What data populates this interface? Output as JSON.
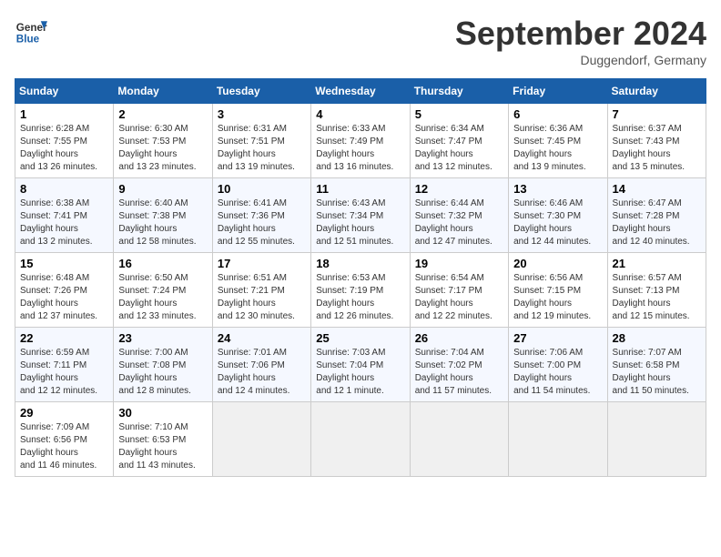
{
  "header": {
    "logo_line1": "General",
    "logo_line2": "Blue",
    "month": "September 2024",
    "location": "Duggendorf, Germany"
  },
  "weekdays": [
    "Sunday",
    "Monday",
    "Tuesday",
    "Wednesday",
    "Thursday",
    "Friday",
    "Saturday"
  ],
  "weeks": [
    [
      {
        "day": "1",
        "sunrise": "6:28 AM",
        "sunset": "7:55 PM",
        "daylight": "13 hours and 26 minutes."
      },
      {
        "day": "2",
        "sunrise": "6:30 AM",
        "sunset": "7:53 PM",
        "daylight": "13 hours and 23 minutes."
      },
      {
        "day": "3",
        "sunrise": "6:31 AM",
        "sunset": "7:51 PM",
        "daylight": "13 hours and 19 minutes."
      },
      {
        "day": "4",
        "sunrise": "6:33 AM",
        "sunset": "7:49 PM",
        "daylight": "13 hours and 16 minutes."
      },
      {
        "day": "5",
        "sunrise": "6:34 AM",
        "sunset": "7:47 PM",
        "daylight": "13 hours and 12 minutes."
      },
      {
        "day": "6",
        "sunrise": "6:36 AM",
        "sunset": "7:45 PM",
        "daylight": "13 hours and 9 minutes."
      },
      {
        "day": "7",
        "sunrise": "6:37 AM",
        "sunset": "7:43 PM",
        "daylight": "13 hours and 5 minutes."
      }
    ],
    [
      {
        "day": "8",
        "sunrise": "6:38 AM",
        "sunset": "7:41 PM",
        "daylight": "13 hours and 2 minutes."
      },
      {
        "day": "9",
        "sunrise": "6:40 AM",
        "sunset": "7:38 PM",
        "daylight": "12 hours and 58 minutes."
      },
      {
        "day": "10",
        "sunrise": "6:41 AM",
        "sunset": "7:36 PM",
        "daylight": "12 hours and 55 minutes."
      },
      {
        "day": "11",
        "sunrise": "6:43 AM",
        "sunset": "7:34 PM",
        "daylight": "12 hours and 51 minutes."
      },
      {
        "day": "12",
        "sunrise": "6:44 AM",
        "sunset": "7:32 PM",
        "daylight": "12 hours and 47 minutes."
      },
      {
        "day": "13",
        "sunrise": "6:46 AM",
        "sunset": "7:30 PM",
        "daylight": "12 hours and 44 minutes."
      },
      {
        "day": "14",
        "sunrise": "6:47 AM",
        "sunset": "7:28 PM",
        "daylight": "12 hours and 40 minutes."
      }
    ],
    [
      {
        "day": "15",
        "sunrise": "6:48 AM",
        "sunset": "7:26 PM",
        "daylight": "12 hours and 37 minutes."
      },
      {
        "day": "16",
        "sunrise": "6:50 AM",
        "sunset": "7:24 PM",
        "daylight": "12 hours and 33 minutes."
      },
      {
        "day": "17",
        "sunrise": "6:51 AM",
        "sunset": "7:21 PM",
        "daylight": "12 hours and 30 minutes."
      },
      {
        "day": "18",
        "sunrise": "6:53 AM",
        "sunset": "7:19 PM",
        "daylight": "12 hours and 26 minutes."
      },
      {
        "day": "19",
        "sunrise": "6:54 AM",
        "sunset": "7:17 PM",
        "daylight": "12 hours and 22 minutes."
      },
      {
        "day": "20",
        "sunrise": "6:56 AM",
        "sunset": "7:15 PM",
        "daylight": "12 hours and 19 minutes."
      },
      {
        "day": "21",
        "sunrise": "6:57 AM",
        "sunset": "7:13 PM",
        "daylight": "12 hours and 15 minutes."
      }
    ],
    [
      {
        "day": "22",
        "sunrise": "6:59 AM",
        "sunset": "7:11 PM",
        "daylight": "12 hours and 12 minutes."
      },
      {
        "day": "23",
        "sunrise": "7:00 AM",
        "sunset": "7:08 PM",
        "daylight": "12 hours and 8 minutes."
      },
      {
        "day": "24",
        "sunrise": "7:01 AM",
        "sunset": "7:06 PM",
        "daylight": "12 hours and 4 minutes."
      },
      {
        "day": "25",
        "sunrise": "7:03 AM",
        "sunset": "7:04 PM",
        "daylight": "12 hours and 1 minute."
      },
      {
        "day": "26",
        "sunrise": "7:04 AM",
        "sunset": "7:02 PM",
        "daylight": "11 hours and 57 minutes."
      },
      {
        "day": "27",
        "sunrise": "7:06 AM",
        "sunset": "7:00 PM",
        "daylight": "11 hours and 54 minutes."
      },
      {
        "day": "28",
        "sunrise": "7:07 AM",
        "sunset": "6:58 PM",
        "daylight": "11 hours and 50 minutes."
      }
    ],
    [
      {
        "day": "29",
        "sunrise": "7:09 AM",
        "sunset": "6:56 PM",
        "daylight": "11 hours and 46 minutes."
      },
      {
        "day": "30",
        "sunrise": "7:10 AM",
        "sunset": "6:53 PM",
        "daylight": "11 hours and 43 minutes."
      },
      null,
      null,
      null,
      null,
      null
    ]
  ]
}
